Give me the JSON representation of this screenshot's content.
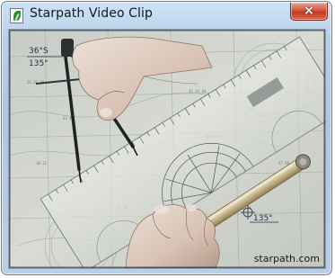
{
  "window": {
    "title": "Starpath Video Clip",
    "close_glyph": "×"
  },
  "icons": {
    "app": "starpath-leaf-icon",
    "close": "close-icon"
  },
  "video": {
    "description_kind": "video-frame",
    "chart_annotations": [
      "36°S",
      "135°",
      "135°"
    ],
    "watermark": "starpath.com"
  },
  "colors": {
    "close_button": "#c9422b",
    "title_gradient_top": "#cfe3f6",
    "title_gradient_bottom": "#adc7e3"
  }
}
